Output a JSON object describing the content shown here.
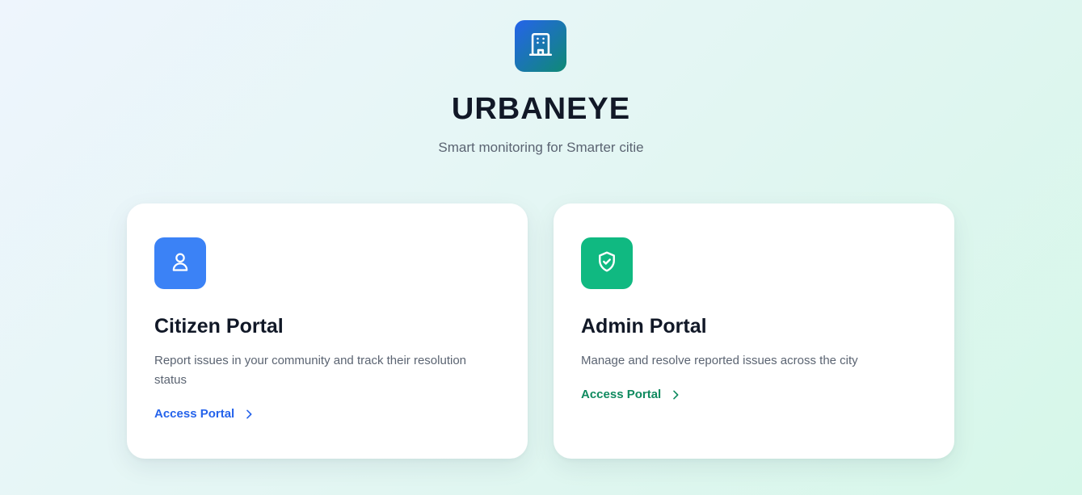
{
  "app": {
    "title": "URBANEYE",
    "subtitle": "Smart monitoring for Smarter citie",
    "logo_icon": "building-icon"
  },
  "portals": [
    {
      "title": "Citizen Portal",
      "description": "Report issues in your community and track their resolution status",
      "link_label": "Access Portal",
      "icon": "user-icon",
      "accent": "#3b82f6",
      "link_color": "#2563eb"
    },
    {
      "title": "Admin Portal",
      "description": "Manage and resolve reported issues across the city",
      "link_label": "Access Portal",
      "icon": "shield-check-icon",
      "accent": "#10b981",
      "link_color": "#0f8a5f"
    }
  ],
  "colors": {
    "logo_gradient_start": "#2563eb",
    "logo_gradient_end": "#0f8a74",
    "text_primary": "#111827",
    "text_secondary": "#5b6472"
  }
}
